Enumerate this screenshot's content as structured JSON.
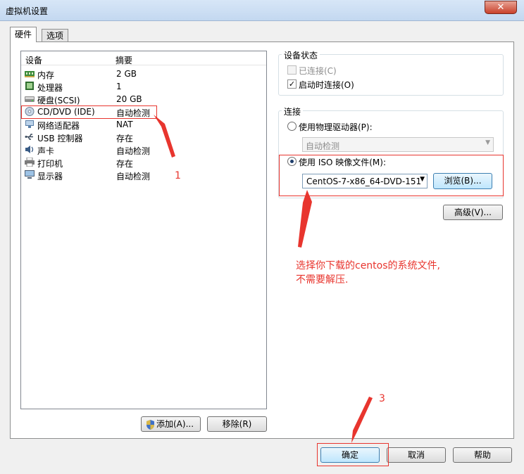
{
  "window": {
    "title": "虚拟机设置",
    "close_glyph": "✕"
  },
  "tabs": [
    {
      "label": "硬件"
    },
    {
      "label": "选项"
    }
  ],
  "device_list": {
    "headers": {
      "device": "设备",
      "summary": "摘要"
    },
    "rows": [
      {
        "icon": "memory-icon",
        "label": "内存",
        "summary": "2 GB"
      },
      {
        "icon": "processor-icon",
        "label": "处理器",
        "summary": "1"
      },
      {
        "icon": "hard-disk-icon",
        "label": "硬盘(SCSI)",
        "summary": "20 GB"
      },
      {
        "icon": "cd-dvd-icon",
        "label": "CD/DVD (IDE)",
        "summary": "自动检测"
      },
      {
        "icon": "network-adapter-icon",
        "label": "网络适配器",
        "summary": "NAT"
      },
      {
        "icon": "usb-icon",
        "label": "USB 控制器",
        "summary": "存在"
      },
      {
        "icon": "sound-card-icon",
        "label": "声卡",
        "summary": "自动检测"
      },
      {
        "icon": "printer-icon",
        "label": "打印机",
        "summary": "存在"
      },
      {
        "icon": "display-icon",
        "label": "显示器",
        "summary": "自动检测"
      }
    ]
  },
  "buttons": {
    "add": "添加(A)...",
    "remove": "移除(R)",
    "browse": "浏览(B)...",
    "advanced": "高级(V)...",
    "ok": "确定",
    "cancel": "取消",
    "help": "帮助"
  },
  "device_status": {
    "title": "设备状态",
    "connected": {
      "label": "已连接(C)",
      "checked": false
    },
    "connect_at_power_on": {
      "label": "启动时连接(O)",
      "checked": true
    }
  },
  "connection": {
    "title": "连接",
    "physical_drive": {
      "label": "使用物理驱动器(P):",
      "selected": false,
      "dropdown_value": "自动检测"
    },
    "iso_image": {
      "label": "使用 ISO 映像文件(M):",
      "selected": true,
      "file_value": "CentOS-7-x86_64-DVD-151"
    }
  },
  "annotations": {
    "step1": "1",
    "step3": "3",
    "note_line1": "选择你下载的centos的系统文件,",
    "note_line2": "不需要解压.",
    "color": "#e8352e"
  },
  "colors": {
    "titlebar": "#c8dcf2",
    "accent": "#3c7fb1",
    "annotation": "#e8352e"
  }
}
